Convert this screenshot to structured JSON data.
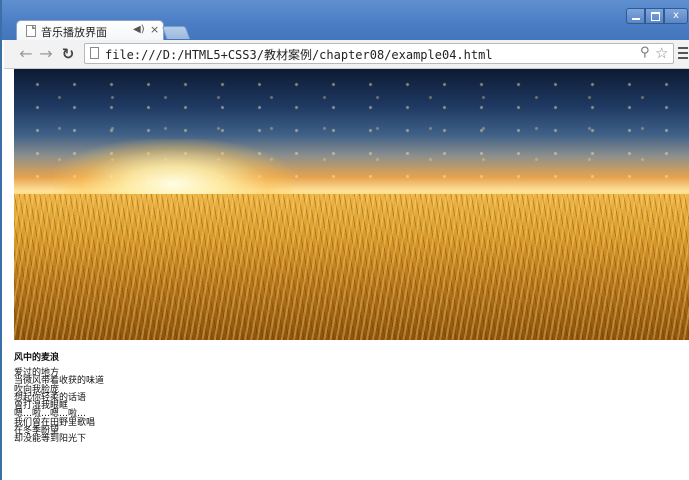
{
  "browser": {
    "tab_title": "音乐播放界面",
    "tab_audio_icon": "speaker-icon",
    "tab_close": "×",
    "url": "file:///D:/HTML5+CSS3/教材案例/chapter08/example04.html",
    "window_controls": {
      "close": "x"
    }
  },
  "page": {
    "hero_image": "wheat-field-sunset-image",
    "song_title": "风中的麦浪",
    "lyrics": [
      "爱过的地方",
      "当微风带着收获的味道",
      "吹向我脸庞",
      "想起你轻柔的话语",
      "曾打湿我眼眶",
      "嗯…啦…嗯…啦…",
      "我们曾在田野里歌唱",
      "在冬季盼望",
      "却没能等到阳光下"
    ]
  },
  "colors": {
    "titlebar": "#4a7dc4",
    "toolbar": "#f2f2f2",
    "wheat": "#d99a2a"
  }
}
